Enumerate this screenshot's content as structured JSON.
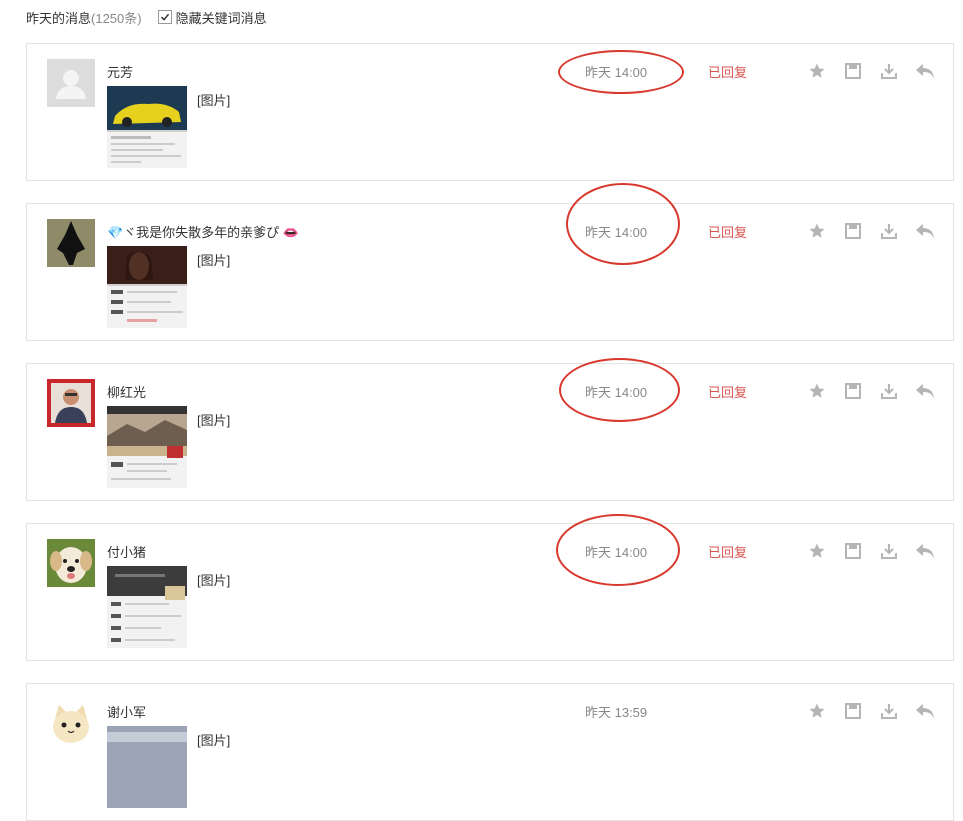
{
  "header": {
    "title": "昨天的消息",
    "count": "(1250条)",
    "hide_keyword_label": "隐藏关键词消息",
    "hide_keyword_checked": true
  },
  "messages": [
    {
      "sender": "元芳",
      "content": "[图片]",
      "time": "昨天 14:00",
      "status": "已回复"
    },
    {
      "sender": "💎ヾ我是你失散多年的亲爹ぴ 👄",
      "content": "[图片]",
      "time": "昨天 14:00",
      "status": "已回复"
    },
    {
      "sender": "柳红光",
      "content": "[图片]",
      "time": "昨天 14:00",
      "status": "已回复"
    },
    {
      "sender": "付小猪",
      "content": "[图片]",
      "time": "昨天 14:00",
      "status": "已回复"
    },
    {
      "sender": "谢小军",
      "content": "[图片]",
      "time": "昨天 13:59",
      "status": ""
    }
  ],
  "icons": {
    "star": "star-icon",
    "save": "save-icon",
    "download": "download-icon",
    "reply": "reply-icon"
  },
  "colors": {
    "replied": "#d9534f",
    "annotation": "#d8382d",
    "icon": "#b5b5b5"
  }
}
